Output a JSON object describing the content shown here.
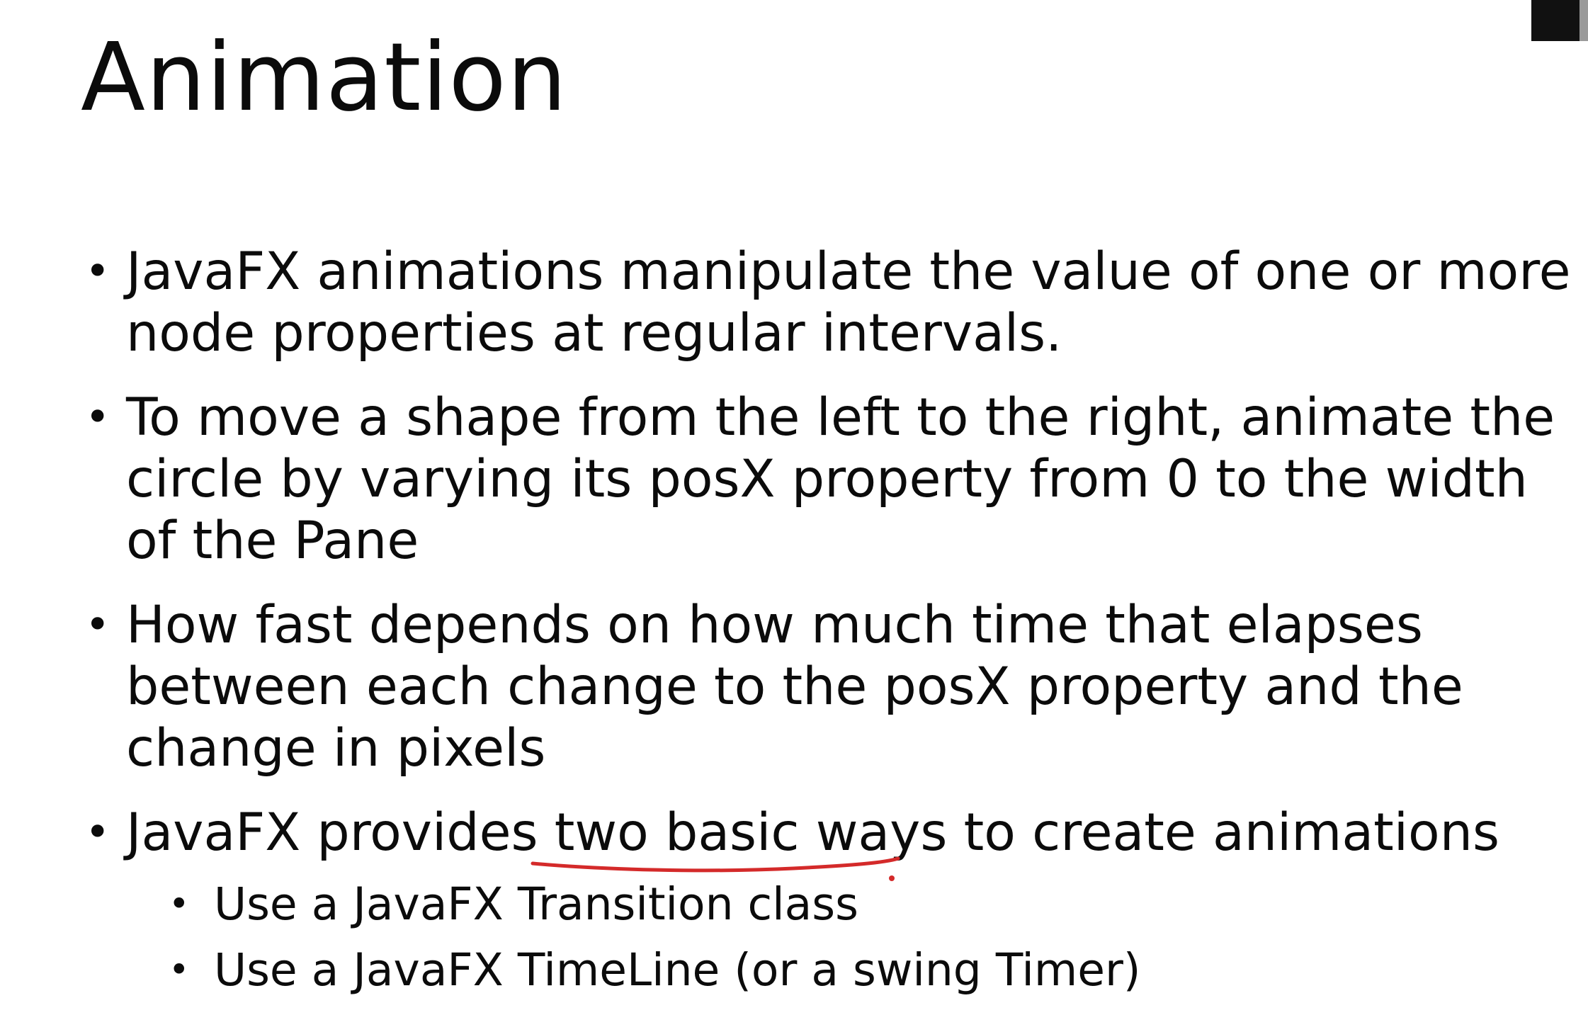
{
  "slide": {
    "title": "Animation",
    "bullets": [
      {
        "lines": [
          "JavaFX animations manipulate the value of one or more",
          "node properties at regular intervals."
        ]
      },
      {
        "lines": [
          "To move a shape from the left to the right, animate the",
          "circle by varying its posX property from 0 to the width",
          "of the Pane"
        ]
      },
      {
        "lines": [
          "How fast depends on how much time that elapses",
          "between each change to the posX property and the",
          "change in pixels"
        ]
      },
      {
        "lines": [
          "JavaFX provides two basic ways to create animations"
        ],
        "sub_bullets": [
          "Use a JavaFX Transition class",
          "Use a JavaFX TimeLine (or a swing Timer)"
        ]
      }
    ],
    "bullet_glyph": "•",
    "annotation_color": "#d42a2a"
  }
}
